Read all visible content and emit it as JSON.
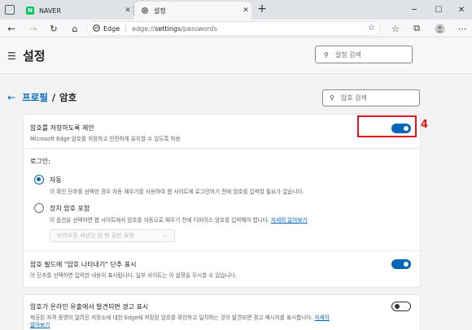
{
  "browser": {
    "tabs": [
      {
        "title": "NAVER",
        "favicon": "naver-logo",
        "favicon_text": "N"
      },
      {
        "title": "설정",
        "favicon": "gear-icon",
        "active": true
      }
    ],
    "new_tab": "+",
    "window_controls": {
      "minimize": "─",
      "maximize": "☐",
      "close": "✕"
    },
    "tab_close": "✕",
    "address": {
      "label": "Edge",
      "url_prefix": "edge://",
      "url_bold": "settings",
      "url_rest": "/passwords"
    },
    "nav_icons": {
      "back": "←",
      "forward": "→",
      "refresh": "↻",
      "home": "⌂"
    }
  },
  "settings": {
    "header_title": "설정",
    "search_placeholder": "설정 검색",
    "breadcrumb": {
      "parent": "프로필",
      "separator": "/",
      "current": "암호"
    },
    "password_search_placeholder": "암호 검색",
    "sections": {
      "offer_save": {
        "title": "암호를 저장하도록 제안",
        "desc": "Microsoft Edge 암호를 저장하고 안전하게 유지할 수 있도록 허용",
        "toggle": true
      },
      "signin": {
        "label": "로그인:",
        "auto": {
          "title": "자동",
          "desc": "이 확인 단추를 선택한 경우 자동 채우기를 사용하여 웹 사이트에 로그인하기 전에 암호를 입력할 필요가 없습니다.",
          "selected": true
        },
        "device": {
          "title": "장치 암호 포함",
          "desc": "이 옵션을 선택하면 웹 사이트에서 암호를 자동으로 채우기 전에 디바이스 암호를 입력해야 합니다.",
          "link": "자세히 알아보기",
          "selected": false
        },
        "dropdown": "브라우징 세션당 한 번 권한 요청"
      },
      "reveal_button": {
        "title": "암호 필드에 \"암호 나타내기\" 단추 표시",
        "desc": "이 단추를 선택하면 입력한 내용이 표시됩니다. 일부 사이트는 이 설정을 무시할 수 있습니다.",
        "toggle": true
      },
      "leak_alert": {
        "title": "암호가 온라인 유출에서 발견되면 경고 표시",
        "desc": "제공된 자격 증명이 알려진 저장소에 대한 Edge에 저장된 암호를 확인하고 일치하는 것이 발견되면 경고 메시지를 표시합니다.",
        "link_a": "자세히",
        "link_b": "알아보기",
        "toggle": false
      }
    }
  },
  "annotation": {
    "label": "4",
    "color": "#e0161e"
  },
  "colors": {
    "accent": "#0067b8",
    "annotation_red": "#e0161e",
    "naver_green": "#03c75a"
  }
}
